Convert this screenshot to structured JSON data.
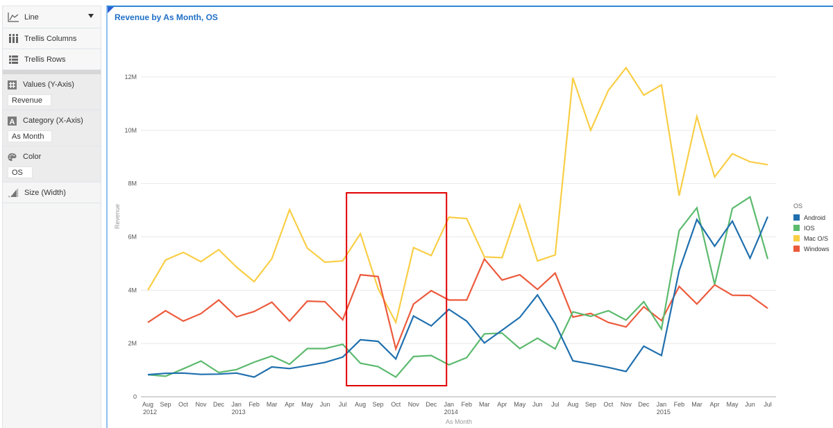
{
  "sidebar": {
    "chart_type": {
      "label": "Line",
      "icon": "line-chart-icon"
    },
    "trellis_columns": {
      "label": "Trellis Columns",
      "icon": "columns-icon"
    },
    "trellis_rows": {
      "label": "Trellis Rows",
      "icon": "rows-icon"
    },
    "sections": [
      {
        "label": "Values (Y-Axis)",
        "icon": "hash-icon",
        "value": "Revenue"
      },
      {
        "label": "Category (X-Axis)",
        "icon": "letter-a-icon",
        "value": "As Month"
      },
      {
        "label": "Color",
        "icon": "palette-icon",
        "value": "OS"
      }
    ],
    "size": {
      "label": "Size (Width)",
      "icon": "size-bars-icon"
    }
  },
  "colors": {
    "accent": "#2c87d4",
    "title": "#1f6fc5",
    "highlight_box": "#e00000"
  },
  "chart_data": {
    "type": "line",
    "title": "Revenue by As Month, OS",
    "xlabel": "As Month",
    "ylabel": "Revenue",
    "ylim": [
      0,
      12000000
    ],
    "yticks": [
      0,
      2000000,
      4000000,
      6000000,
      8000000,
      10000000,
      12000000
    ],
    "ytick_labels": [
      "0",
      "2M",
      "4M",
      "6M",
      "8M",
      "10M",
      "12M"
    ],
    "grid": true,
    "legend_title": "OS",
    "legend_position": "right",
    "categories": [
      "Aug",
      "Sep",
      "Oct",
      "Nov",
      "Dec",
      "Jan",
      "Feb",
      "Mar",
      "Apr",
      "May",
      "Jun",
      "Jul",
      "Aug",
      "Sep",
      "Oct",
      "Nov",
      "Dec",
      "Jan",
      "Feb",
      "Mar",
      "Apr",
      "May",
      "Jun",
      "Jul",
      "Aug",
      "Sep",
      "Oct",
      "Nov",
      "Dec",
      "Jan",
      "Feb",
      "Mar",
      "Apr",
      "May",
      "Jun",
      "Jul"
    ],
    "year_labels": {
      "0": "2012",
      "5": "2013",
      "17": "2014",
      "29": "2015"
    },
    "series": [
      {
        "name": "Android",
        "color": "#1f6fae",
        "values": [
          0.83,
          0.88,
          0.89,
          0.84,
          0.85,
          0.89,
          0.74,
          1.12,
          1.06,
          1.17,
          1.29,
          1.49,
          2.14,
          2.08,
          1.42,
          3.03,
          2.66,
          3.28,
          2.84,
          2.02,
          2.5,
          2.98,
          3.82,
          2.74,
          1.35,
          1.23,
          1.1,
          0.95,
          1.9,
          1.55,
          4.74,
          6.65,
          5.65,
          6.59,
          5.2,
          6.76
        ]
      },
      {
        "name": "IOS",
        "color": "#5cba6e",
        "values": [
          0.83,
          0.77,
          1.05,
          1.34,
          0.91,
          1.02,
          1.3,
          1.53,
          1.22,
          1.81,
          1.81,
          1.97,
          1.26,
          1.13,
          0.74,
          1.51,
          1.55,
          1.2,
          1.47,
          2.36,
          2.39,
          1.81,
          2.2,
          1.8,
          3.19,
          3.02,
          3.23,
          2.88,
          3.57,
          2.54,
          6.24,
          7.09,
          4.22,
          7.07,
          7.5,
          5.17
        ]
      },
      {
        "name": "Mac O/S",
        "color": "#f9ce45",
        "values": [
          4.0,
          5.13,
          5.42,
          5.07,
          5.52,
          4.87,
          4.32,
          5.18,
          7.02,
          5.58,
          5.05,
          5.1,
          6.12,
          4.06,
          2.79,
          5.6,
          5.3,
          6.74,
          6.69,
          5.25,
          5.22,
          7.2,
          5.1,
          5.32,
          11.97,
          10.0,
          11.5,
          12.35,
          11.32,
          11.7,
          7.55,
          10.52,
          8.25,
          9.12,
          8.82,
          8.71
        ]
      },
      {
        "name": "Windows",
        "color": "#ec5a3c",
        "values": [
          2.79,
          3.23,
          2.84,
          3.12,
          3.63,
          3.0,
          3.2,
          3.55,
          2.84,
          3.59,
          3.57,
          2.89,
          4.58,
          4.51,
          1.8,
          3.48,
          3.98,
          3.63,
          3.63,
          5.17,
          4.38,
          4.58,
          4.03,
          4.64,
          2.99,
          3.13,
          2.79,
          2.62,
          3.38,
          2.86,
          4.14,
          3.48,
          4.2,
          3.81,
          3.8,
          3.32
        ]
      }
    ],
    "values_unit": "millions",
    "annotations": [
      {
        "type": "highlight-rectangle",
        "from_index": 12,
        "to_index": 16,
        "description": "Aug 2013 – Dec 2013"
      }
    ]
  }
}
